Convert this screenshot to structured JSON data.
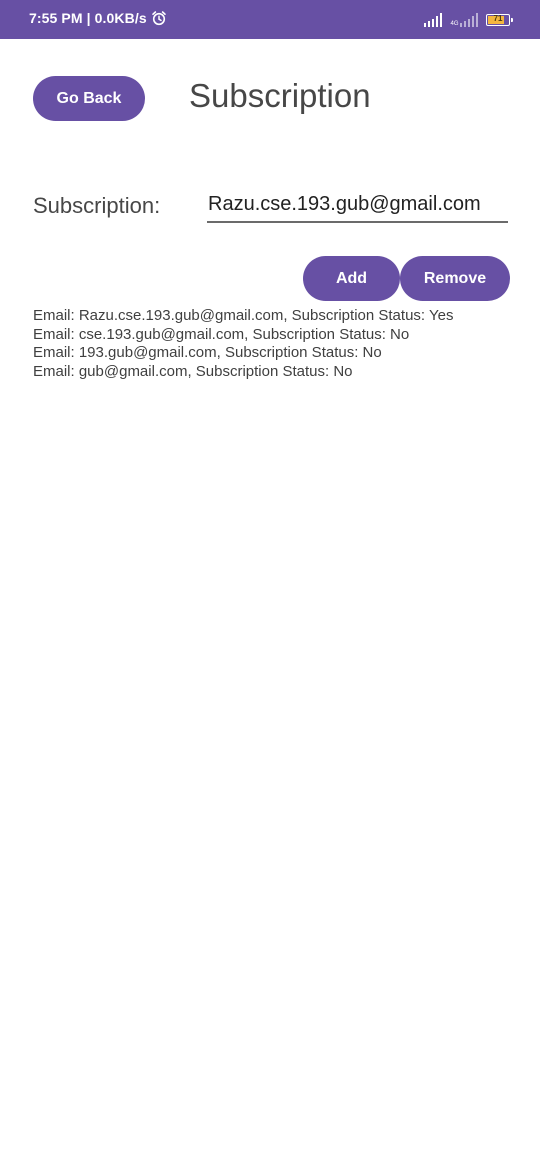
{
  "status_bar": {
    "time": "7:55 PM",
    "separator": "|",
    "data_rate": "0.0KB/s",
    "network_type": "4G",
    "battery_level": "71",
    "colors": {
      "background": "#6750a4",
      "battery_fill": "#f3b63f"
    }
  },
  "header": {
    "back_label": "Go Back",
    "title": "Subscription"
  },
  "form": {
    "label": "Subscription:",
    "email_value": "Razu.cse.193.gub@gmail.com"
  },
  "actions": {
    "add_label": "Add",
    "remove_label": "Remove"
  },
  "results": [
    "Email: Razu.cse.193.gub@gmail.com, Subscription Status: Yes",
    "Email: cse.193.gub@gmail.com, Subscription Status: No",
    "Email: 193.gub@gmail.com, Subscription Status: No",
    "Email: gub@gmail.com, Subscription Status: No"
  ],
  "theme": {
    "accent": "#6750a4",
    "text": "#474747"
  }
}
